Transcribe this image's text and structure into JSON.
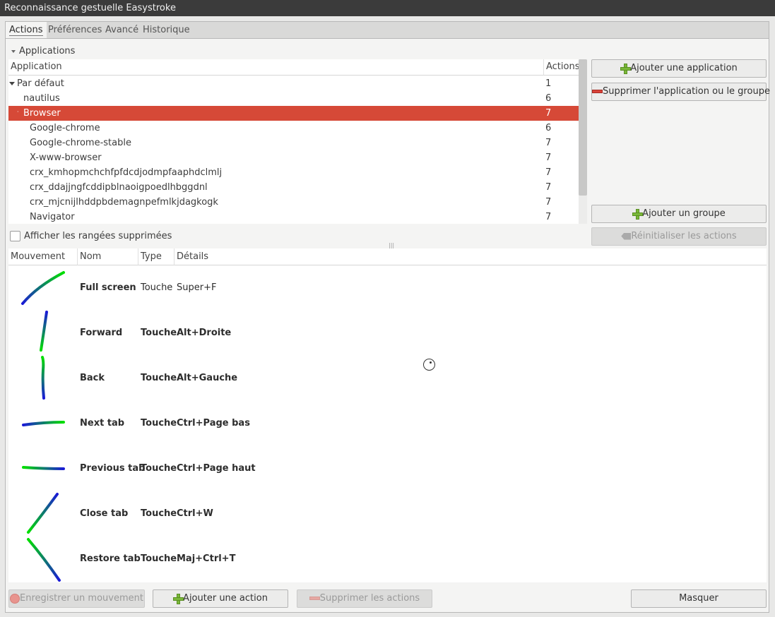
{
  "window": {
    "title": "Reconnaissance gestuelle Easystroke"
  },
  "tabs": [
    {
      "label": "Actions",
      "active": true
    },
    {
      "label": "Préférences"
    },
    {
      "label": "Avancé"
    },
    {
      "label": "Historique"
    }
  ],
  "applications": {
    "expander_label": "Applications",
    "columns": {
      "application": "Application",
      "actions": "Actions"
    },
    "rows": [
      {
        "name": "Par défaut",
        "count": "1",
        "level": 0,
        "expanded": true
      },
      {
        "name": "nautilus",
        "count": "6",
        "level": 1
      },
      {
        "name": "Browser",
        "count": "7",
        "level": 1,
        "selected": true,
        "expanded": true
      },
      {
        "name": "Google-chrome",
        "count": "6",
        "level": 2
      },
      {
        "name": "Google-chrome-stable",
        "count": "7",
        "level": 2
      },
      {
        "name": "X-www-browser",
        "count": "7",
        "level": 2
      },
      {
        "name": "crx_kmhopmchchfpfdcdjodmpfaaphdclmlj",
        "count": "7",
        "level": 2
      },
      {
        "name": "crx_ddajjngfcddipblnaoigpoedlhbggdnl",
        "count": "7",
        "level": 2
      },
      {
        "name": "crx_mjcnijlhddpbdemagnpefmlkjdagkogk",
        "count": "7",
        "level": 2
      },
      {
        "name": "Navigator",
        "count": "7",
        "level": 2
      }
    ],
    "show_deleted_label": "Afficher les rangées supprimées",
    "show_deleted_checked": false
  },
  "side_buttons": {
    "add_app": "Ajouter une application",
    "remove_app": "Supprimer l'application ou le groupe",
    "add_group": "Ajouter un groupe",
    "reset_actions": "Réinitialiser les actions"
  },
  "actions_list": {
    "columns": {
      "gesture": "Mouvement",
      "name": "Nom",
      "type": "Type",
      "details": "Détails"
    },
    "rows": [
      {
        "name": "Full screen",
        "type": "Touche",
        "details": "Super+F",
        "gesture": "diag-up-right",
        "bold": false
      },
      {
        "name": "Forward",
        "type": "Touche",
        "details": "Alt+Droite",
        "gesture": "vertical-down-blue-top",
        "bold": true
      },
      {
        "name": "Back",
        "type": "Touche",
        "details": "Alt+Gauche",
        "gesture": "vertical-down-green-top",
        "bold": true
      },
      {
        "name": "Next tab",
        "type": "Touche",
        "details": "Ctrl+Page bas",
        "gesture": "horizontal-right",
        "bold": true
      },
      {
        "name": "Previous tab",
        "type": "Touche",
        "details": "Ctrl+Page haut",
        "gesture": "horizontal-left",
        "bold": true
      },
      {
        "name": "Close tab",
        "type": "Touche",
        "details": "Ctrl+W",
        "gesture": "chevron-left-up",
        "bold": true
      },
      {
        "name": "Restore tab",
        "type": "Touche",
        "details": "Maj+Ctrl+T",
        "gesture": "chevron-left-down",
        "bold": true
      }
    ]
  },
  "bottom_buttons": {
    "record": "Enregistrer un mouvement",
    "add_action": "Ajouter une action",
    "delete_actions": "Supprimer les actions",
    "hide": "Masquer"
  },
  "colors": {
    "selection": "#d64937",
    "gesture_start": "#00e000",
    "gesture_end": "#1a1ad6"
  }
}
